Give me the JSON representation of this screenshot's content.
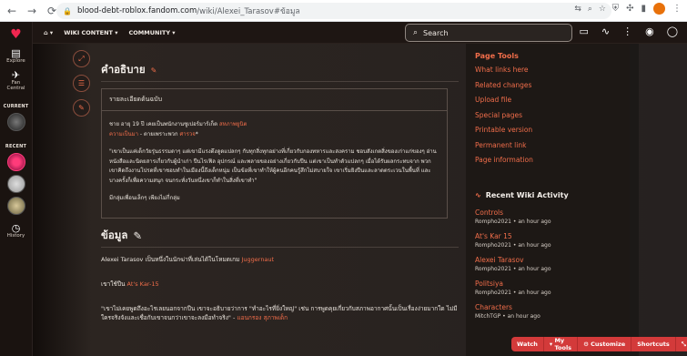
{
  "browser": {
    "url_host": "blood-debt-roblox.fandom.com",
    "url_path": "/wiki/Alexei_Tarasov#ข้อมูล"
  },
  "left_rail": {
    "items": [
      {
        "label": "Explore",
        "icon": "explore-icon"
      },
      {
        "label": "Fan Central",
        "icon": "fan-central-icon"
      }
    ],
    "current_label": "CURRENT",
    "recent_label": "RECENT",
    "history_label": "History"
  },
  "topbar": {
    "community_menu": "WIKI CONTENT",
    "community2_menu": "COMMUNITY",
    "search_placeholder": "Search"
  },
  "article": {
    "section1_title": "คำอธิบาย",
    "box_header": "รายละเอียดต้นฉบับ",
    "p1_a": "ชาย อายุ 19 ปี เคยเป็นพนักงานซูเปอร์มาร์เก็ต ",
    "p1_link1": "สหภาพยูนิต",
    "p1_link2": "ความเป็นมา",
    "p1_b": " - ตายเพราะพวก ",
    "p1_link3": "ศารวจ",
    "p1_c": "*",
    "p2": "\"เขาเป็นแค่เด็กวัยรุ่นธรรมดาๆ แต่เขามีแรงดึงดูดแปลกๆ กับทุกสิ่งทุกอย่างที่เกี่ยวกับกองทหารและสงคราม ชอบสังเกตสิ่งของเก่าแก่ของๆ อ่านหนังสือและนิตยสารเกี่ยวกับผู้นำเก่า ปืนไรเฟิล อุปกรณ์ และพลายของอย่างเกี่ยวกับปืน แต่เขาเป็นทำตัวแปลกๆ เมื่อได้รับผลกระทบจาก พวกเขาคิดถึงงานโปรดที่เขาชอบทำในเมืองนี้ถึงเด็กหนุ่ม เป็นข้อที่เขาทำให้ผู้คนอีกคนรู้สึกไม่สบายใจ เขาเริ่มยิงปืนและลาดตระเวนในพื้นที่ และบางครั้งก็เพื่อความสนุก จนกระทั่งวันหนึ่งเขาก็ทำในสิ่งที่เขาทำ\"",
    "p3": "มีกลุ่มเพื่อนเล็กๆ เพียงไม่กี่กลุ่ม",
    "section2_title": "ข้อมูล",
    "s2_p1_a": "Alexei Tarasov เป็นหนึ่งในนักฆ่าที่เล่นได้ในโหมดเกม ",
    "s2_p1_link": "Juggernaut",
    "s2_p2_a": "เขาใช้ปืน ",
    "s2_p2_link": "At's Kar-15",
    "s2_p3": "\"เขาไม่เคยพูดถึงอะไรเลยนอกจากปืน เขาจะอธิบายว่าการ \"ทำอะไรที่ยิ่งใหญ่\" เช่น การพูดคุยเกี่ยวกับสภาพอากาศนั้นเป็นเรื่องง่ายมากใด ไม่มีใครจริงจังและเชื่อกับเขาจนกว่าเขาจะลงมือทำจริง\" - ",
    "s2_p3_link": "แอนกรอง สุภาพเด็ก"
  },
  "page_tools": {
    "title": "Page Tools",
    "links": [
      "What links here",
      "Related changes",
      "Upload file",
      "Special pages",
      "Printable version",
      "Permanent link",
      "Page information"
    ]
  },
  "recent_activity": {
    "title": "Recent Wiki Activity",
    "items": [
      {
        "title": "Controls",
        "meta": "Rompho2021 • an hour ago"
      },
      {
        "title": "At's Kar 15",
        "meta": "Rompho2021 • an hour ago"
      },
      {
        "title": "Alexei Tarasov",
        "meta": "Rompho2021 • an hour ago"
      },
      {
        "title": "Politsiya",
        "meta": "Rompho2021 • an hour ago"
      },
      {
        "title": "Characters",
        "meta": "MitchTGP • an hour ago"
      }
    ]
  },
  "action_bar": {
    "watch": "Watch",
    "my_tools": "My Tools",
    "customize": "Customize",
    "shortcuts": "Shortcuts"
  },
  "colors": {
    "accent": "#f06d4a",
    "background": "#262120"
  }
}
